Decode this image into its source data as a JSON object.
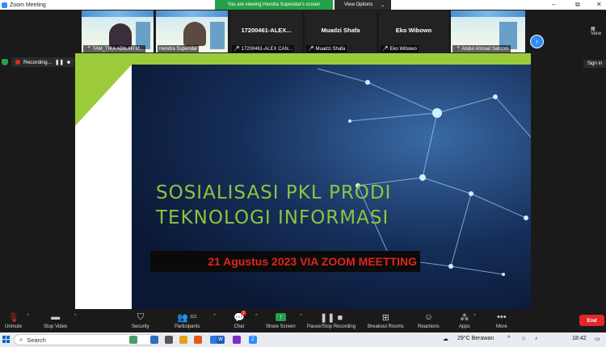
{
  "window": {
    "title": "Zoom Meeting",
    "minimize": "–",
    "maximize": "⧉",
    "close": "✕"
  },
  "share_banner": {
    "text": "You are viewing Hendra Supendar's screen"
  },
  "view_options": {
    "label": "View Options",
    "caret": "⌄"
  },
  "participants_strip": [
    {
      "name": "TAM_TIKA ADILAH M...",
      "has_video": true,
      "muted": true,
      "person_color": "#3b2d3a"
    },
    {
      "name": "Hendra Supendar",
      "has_video": true,
      "muted": false,
      "person_color": "#5b4a3f"
    },
    {
      "name": "17200461-ALEX CAN...",
      "center_label": "17200461-ALEX...",
      "has_video": false,
      "muted": true
    },
    {
      "name": "Muadzi Shafa",
      "center_label": "Muadzi Shafa",
      "has_video": false,
      "muted": true
    },
    {
      "name": "Eko Wibowo",
      "center_label": "Eko Wibowo",
      "has_video": false,
      "muted": true
    },
    {
      "name": "Abdul Ahmad Sahroni",
      "has_video": true,
      "muted": true,
      "person_color": "#d0d8dc"
    }
  ],
  "strip_view_label": "View",
  "recording": {
    "label": "Recording...",
    "pause": "❚❚",
    "stop": "■"
  },
  "signin": "Sign in",
  "slide": {
    "title_line1": "SOSIALISASI PKL PRODI",
    "title_line2": "TEKNOLOGI INFORMASI",
    "date": "21 Agustus 2023 VIA ZOOM MEETTING",
    "colors": {
      "title": "#8dc53e",
      "date": "#e1241b",
      "accent_strip": "#9bcb3b"
    }
  },
  "toolbar": {
    "unmute": "Unmute",
    "stop_video": "Stop Video",
    "security": "Security",
    "participants": "Participants",
    "participants_count": "321",
    "chat": "Chat",
    "chat_badge": "1",
    "share_screen": "Share Screen",
    "pause_stop_recording": "Pause/Stop Recording",
    "breakout_rooms": "Breakout Rooms",
    "reactions": "Reactions",
    "apps": "Apps",
    "more": "More",
    "end": "End"
  },
  "taskbar": {
    "search_placeholder": "Search",
    "weather": "29°C  Berawan",
    "time": "18:42",
    "tray_caret": "^"
  }
}
